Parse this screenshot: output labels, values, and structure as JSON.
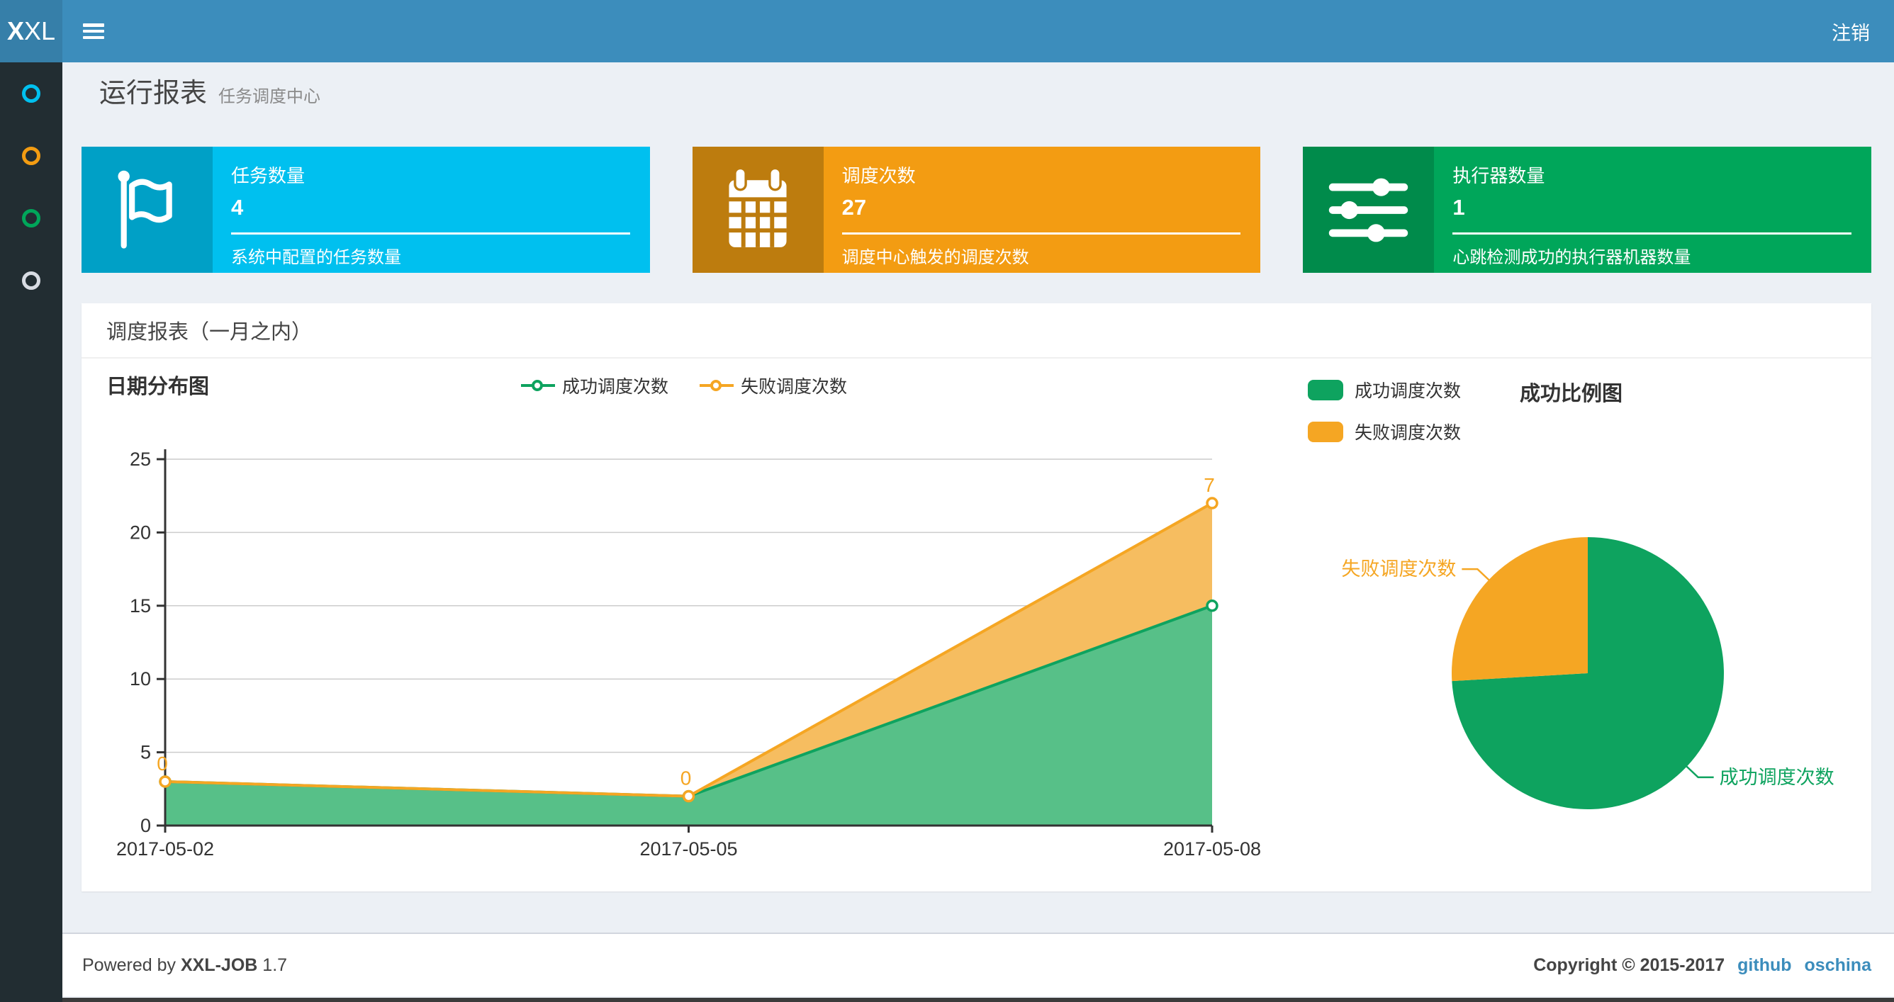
{
  "theme": {
    "navbar_bg": "#3c8dbc",
    "logo_bg": "#367fa9",
    "sidebar_bg": "#222d32",
    "content_bg": "#ecf0f5",
    "success_green": "#0EA35F",
    "fail_orange": "#F5A623"
  },
  "navbar": {
    "logo_bold": "X",
    "logo_rest": "XL",
    "logout_label": "注销"
  },
  "sidebar": {
    "items": [
      {
        "icon": "circle-outline-icon",
        "color": "#00c0ef"
      },
      {
        "icon": "circle-outline-icon",
        "color": "#f39c12"
      },
      {
        "icon": "circle-outline-icon",
        "color": "#00a65a"
      },
      {
        "icon": "circle-outline-icon",
        "color": "#d8dce3"
      }
    ]
  },
  "header": {
    "title": "运行报表",
    "subtitle": "任务调度中心"
  },
  "cards": [
    {
      "label": "任务数量",
      "value": "4",
      "desc": "系统中配置的任务数量",
      "icon": "flag-icon",
      "bg": "#00c0ef",
      "icon_bg": "#00a0c6"
    },
    {
      "label": "调度次数",
      "value": "27",
      "desc": "调度中心触发的调度次数",
      "icon": "calendar-icon",
      "bg": "#f39c12",
      "icon_bg": "#bd7c0e"
    },
    {
      "label": "执行器数量",
      "value": "1",
      "desc": "心跳检测成功的执行器机器数量",
      "icon": "sliders-icon",
      "bg": "#00a65a",
      "icon_bg": "#008b4b"
    }
  ],
  "panel": {
    "title": "调度报表（一月之内）"
  },
  "chart_data": [
    {
      "type": "area",
      "title": "日期分布图",
      "x": [
        "2017-05-02",
        "2017-05-05",
        "2017-05-08"
      ],
      "series": [
        {
          "name": "成功调度次数",
          "values": [
            3,
            2,
            15
          ],
          "color": "#0EA35F",
          "fill": "#57C088"
        },
        {
          "name": "失败调度次数",
          "values": [
            0,
            0,
            7
          ],
          "color": "#F5A623",
          "fill": "#F6BD60",
          "point_labels": [
            "0",
            "0",
            "7"
          ]
        }
      ],
      "stacked": true,
      "ylim": [
        0,
        25
      ],
      "ytick_step": 5,
      "yticks": [
        0,
        5,
        10,
        15,
        20,
        25
      ],
      "grid": "horizontal",
      "legend_position": "top-center"
    },
    {
      "type": "pie",
      "title": "成功比例图",
      "slices": [
        {
          "name": "成功调度次数",
          "value": 20,
          "color": "#0EA35F"
        },
        {
          "name": "失败调度次数",
          "value": 7,
          "color": "#F5A623"
        }
      ],
      "legend_position": "top-left"
    }
  ],
  "footer": {
    "powered_prefix": "Powered by",
    "brand": "XXL-JOB",
    "version": "1.7",
    "copyright": "Copyright © 2015-2017",
    "links": [
      "github",
      "oschina"
    ],
    "link_color": "#3c8dbc"
  }
}
